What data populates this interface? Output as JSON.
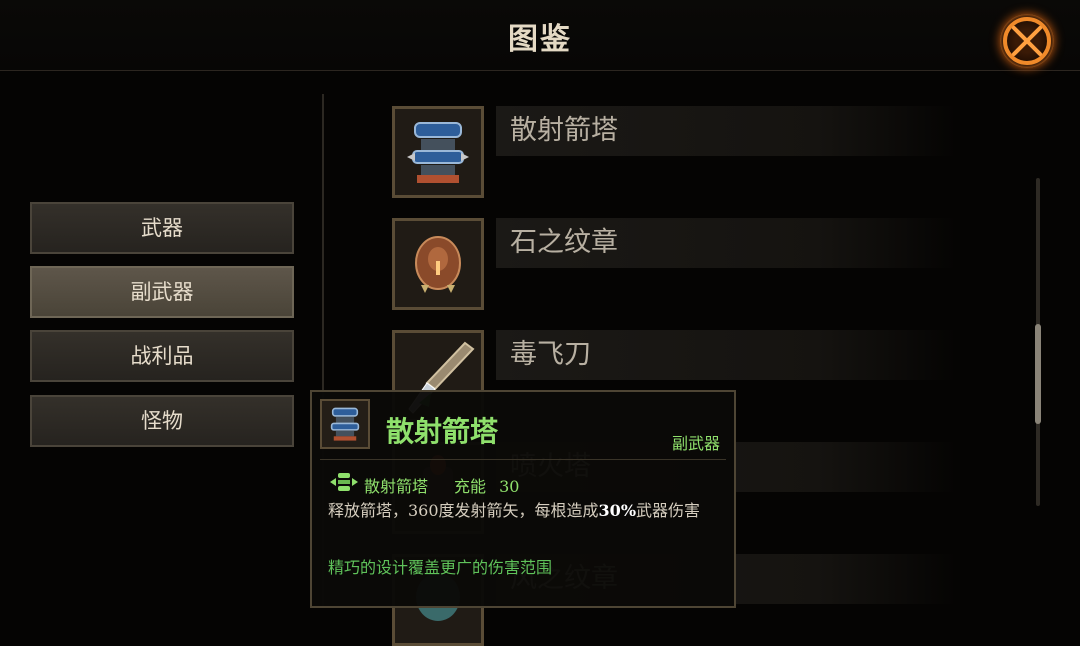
{
  "header": {
    "title": "图鉴"
  },
  "categories": [
    {
      "label": "武器",
      "active": false
    },
    {
      "label": "副武器",
      "active": true
    },
    {
      "label": "战利品",
      "active": false
    },
    {
      "label": "怪物",
      "active": false
    }
  ],
  "items": [
    {
      "name": "散射箭塔",
      "icon": "scatter-arrow-tower-icon"
    },
    {
      "name": "石之纹章",
      "icon": "stone-crest-icon"
    },
    {
      "name": "毒飞刀",
      "icon": "poison-throwing-knife-icon"
    },
    {
      "name": "喷火塔",
      "icon": "flamethrower-tower-icon"
    },
    {
      "name": "风之纹章",
      "icon": "wind-crest-icon"
    }
  ],
  "tooltip": {
    "name": "散射箭塔",
    "type": "副武器",
    "skill_name": "散射箭塔",
    "charge_label": "充能",
    "charge_value": "30",
    "desc_part1": "释放箭塔，360度发射箭矢，每根造成",
    "desc_highlight": "30%",
    "desc_part2": "武器伤害",
    "flavor": "精巧的设计覆盖更广的伤害范围"
  },
  "colors": {
    "accent_green": "#8fe06c",
    "flavor_green": "#5fc25a",
    "close_glow": "#c45a10"
  }
}
